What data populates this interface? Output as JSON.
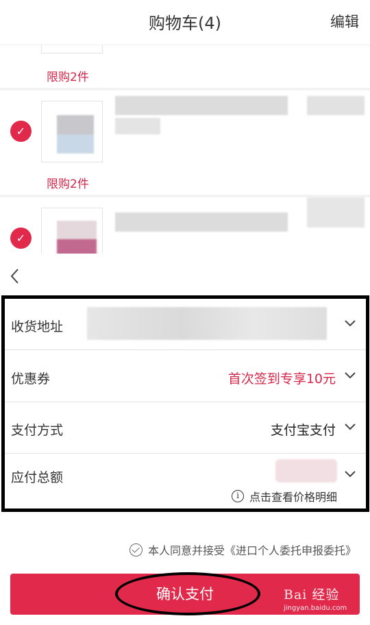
{
  "header": {
    "title": "购物车(4)",
    "edit_label": "编辑"
  },
  "cart": {
    "items": [
      {
        "limit_label": "限购2件",
        "checked": false
      },
      {
        "limit_label": "限购2件",
        "checked": true
      },
      {
        "checked": true
      }
    ]
  },
  "order": {
    "rows": [
      {
        "label": "收货地址",
        "value": ""
      },
      {
        "label": "优惠券",
        "value": "首次签到专享10元"
      },
      {
        "label": "支付方式",
        "value": "支付宝支付"
      },
      {
        "label": "应付总额",
        "value": ""
      }
    ],
    "price_detail_label": "点击查看价格明细",
    "agreement_text": "本人同意并接受《进口个人委托申报委托》",
    "confirm_label": "确认支付"
  },
  "watermark": {
    "main": "Bai 经验",
    "sub": "jingyan.baidu.com"
  },
  "colors": {
    "accent": "#e0294b",
    "coupon_text": "#d6264a",
    "frame": "#000000"
  }
}
